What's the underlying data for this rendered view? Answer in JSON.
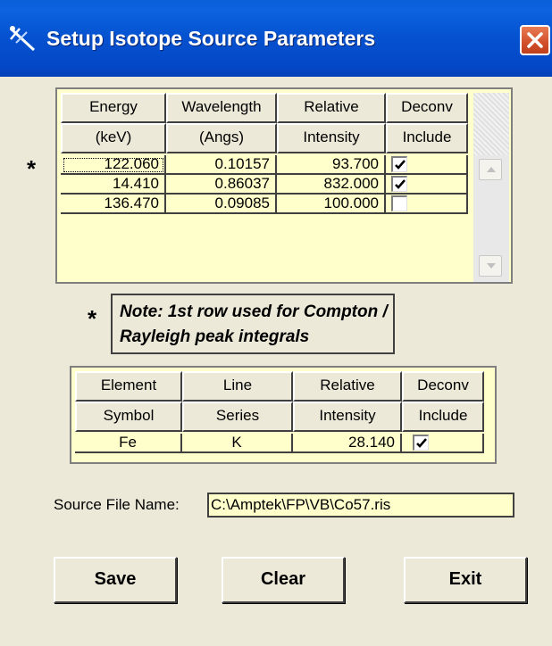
{
  "window": {
    "title": "Setup Isotope Source Parameters"
  },
  "energy_table": {
    "headers_row1": [
      "Energy",
      "Wavelength",
      "Relative",
      "Deconv"
    ],
    "headers_row2": [
      "(keV)",
      "(Angs)",
      "Intensity",
      "Include"
    ],
    "rows": [
      {
        "energy": "122.060",
        "wavelength": "0.10157",
        "intensity": "93.700",
        "include": true
      },
      {
        "energy": "14.410",
        "wavelength": "0.86037",
        "intensity": "832.000",
        "include": true
      },
      {
        "energy": "136.470",
        "wavelength": "0.09085",
        "intensity": "100.000",
        "include": false
      }
    ],
    "row_marker": "*"
  },
  "note": {
    "marker": "*",
    "text": "Note: 1st row used for Compton / Rayleigh peak integrals"
  },
  "element_table": {
    "headers_row1": [
      "Element",
      "Line",
      "Relative",
      "Deconv"
    ],
    "headers_row2": [
      "Symbol",
      "Series",
      "Intensity",
      "Include"
    ],
    "rows": [
      {
        "element": "Fe",
        "series": "K",
        "intensity": "28.140",
        "include": true
      }
    ]
  },
  "source_file": {
    "label": "Source File Name:",
    "value": "C:\\Amptek\\FP\\VB\\Co57.ris"
  },
  "buttons": {
    "save": "Save",
    "clear": "Clear",
    "exit": "Exit"
  },
  "icons": {
    "title": "xray-source-icon",
    "close": "close-icon",
    "check": "checkmark-icon"
  },
  "colors": {
    "titlebar": "#0551cf",
    "grid_bg": "#ffffcc",
    "dialog_bg": "#ece9d8",
    "close": "#d1502a"
  }
}
